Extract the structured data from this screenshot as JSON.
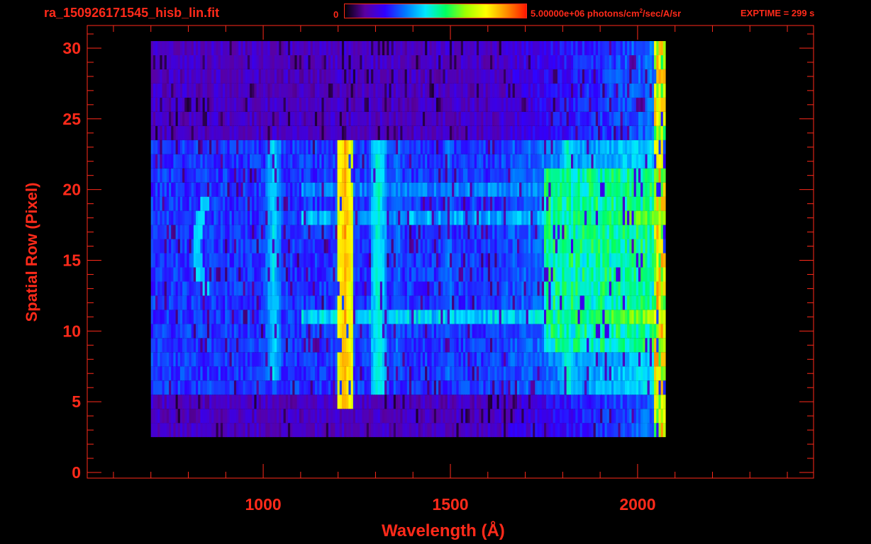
{
  "header": {
    "filename": "ra_150926171545_hisb_lin.fit",
    "colorbar_min": "0",
    "colorbar_max_prefix": "5.00000e+06 photons/cm",
    "colorbar_max_sup": "2",
    "colorbar_max_suffix": "/sec/A/sr",
    "exptime": "EXPTIME = 299 s"
  },
  "colors": {
    "text": "#ff2a1a",
    "axis": "#ff2a1a",
    "background": "#000000",
    "colormap": [
      "#000000",
      "#5a00a0",
      "#3000ff",
      "#0078ff",
      "#00e8ff",
      "#00ff60",
      "#a0ff00",
      "#ffff00",
      "#ff9000",
      "#ff1800"
    ]
  },
  "chart_data": {
    "type": "heatmap",
    "title": "ra_150926171545_hisb_lin.fit",
    "xlabel": "Wavelength (Å)",
    "ylabel": "Spatial Row (Pixel)",
    "xlim": [
      530,
      2470
    ],
    "ylim": [
      -0.4,
      31.6
    ],
    "xticks": [
      1000,
      1500,
      2000
    ],
    "yticks": [
      0,
      5,
      10,
      15,
      20,
      25,
      30
    ],
    "x_minor_step": 100,
    "y_minor_step": 1,
    "colorbar": {
      "min": 0,
      "max": 5000000,
      "units": "photons/cm^2/sec/A/sr"
    },
    "exptime_s": 299,
    "data_extent": {
      "x": [
        700,
        2070
      ],
      "rows": [
        3,
        30
      ]
    },
    "emission_lines": [
      {
        "wavelength": 1025,
        "rows": [
          7,
          23
        ],
        "level": 0.4
      },
      {
        "wavelength": 1216,
        "rows": [
          5,
          23
        ],
        "level": 0.82
      },
      {
        "wavelength": 1304,
        "rows": [
          6,
          23
        ],
        "level": 0.45
      },
      {
        "wavelength": 1356,
        "rows": [
          7,
          23
        ],
        "level": 0.3
      },
      {
        "wavelength": 1493,
        "rows": [
          7,
          23
        ],
        "level": 0.3
      },
      {
        "wavelength": 1810,
        "rows": [
          6,
          23
        ],
        "level": 0.45
      }
    ],
    "bright_rows": [
      {
        "row": 11,
        "level": 0.5
      },
      {
        "row": 18,
        "level": 0.45
      },
      {
        "row": 20,
        "level": 0.4
      }
    ],
    "arc_feature": {
      "x": [
        810,
        870
      ],
      "rows": [
        13,
        19
      ],
      "level": 0.4
    },
    "continuum": {
      "x_start": 1750,
      "x_end": 2070,
      "rows": [
        9,
        21
      ],
      "level": 0.55
    }
  }
}
